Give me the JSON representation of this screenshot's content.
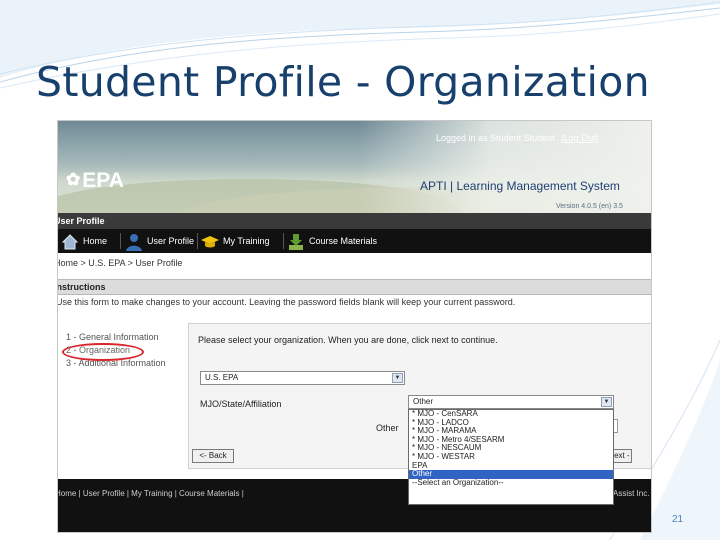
{
  "slide": {
    "title": "Student Profile - Organization",
    "page_number": "21"
  },
  "header": {
    "logged_in_text": "Logged in as Student Student",
    "logout_label": "[Log Out]",
    "logo_text": "EPA",
    "system_title": "APTI | Learning Management System",
    "version_text": "Version 4.0.5 (en) 3.5"
  },
  "section_bar": {
    "title": "User Profile"
  },
  "nav": {
    "items": [
      {
        "label": "Home"
      },
      {
        "label": "User Profile"
      },
      {
        "label": "My Training"
      },
      {
        "label": "Course Materials"
      }
    ]
  },
  "breadcrumb": "Home > U.S. EPA > User Profile",
  "instructions": {
    "title": "Instructions",
    "text": "Use this form to make changes to your account. Leaving the password fields blank will keep your current password."
  },
  "steps": [
    "1 - General Information",
    "2 - Organization",
    "3 - Additional Information"
  ],
  "form": {
    "prompt": "Please select your organization. When you are done, click next to continue.",
    "agency_value": "U.S. EPA",
    "mjo_label": "MJO/State/Affiliation",
    "mjo_value": "Other",
    "other_label": "Other",
    "back_label": "<- Back",
    "next_label": "Next ->"
  },
  "dropdown": {
    "options": [
      "* MJO - CenSARA",
      "* MJO - LADCO",
      "* MJO - MARAMA",
      "* MJO - Metro 4/SESARM",
      "* MJO - NESCAUM",
      "* MJO - WESTAR",
      "EPA",
      "Other",
      "--Select an Organization--"
    ],
    "selected_index": 7
  },
  "footer": {
    "links": "Home | User Profile | My Training | Course Materials |",
    "right_text": "Assist Inc."
  },
  "colors": {
    "title": "#17406d",
    "highlight_circle": "#d9262a",
    "selected_option": "#3163c4"
  }
}
